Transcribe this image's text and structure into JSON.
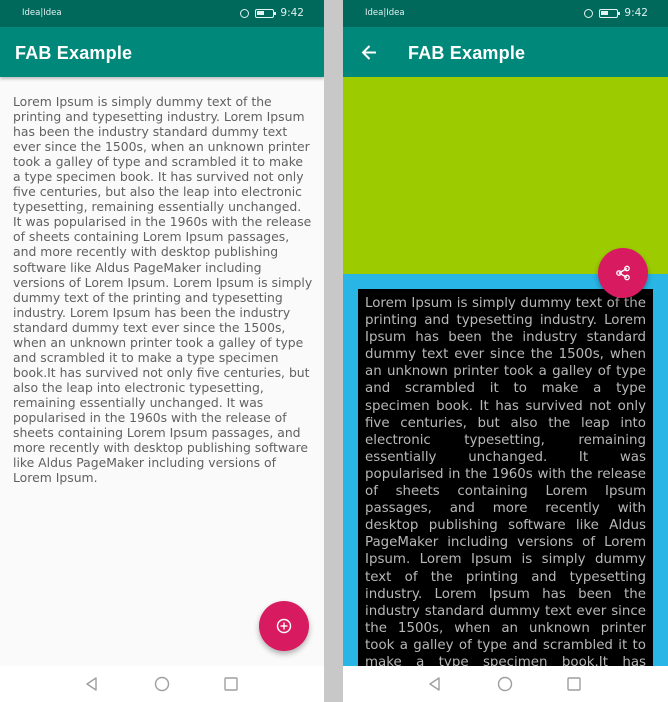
{
  "status_bar": {
    "carrier": "Idea|Idea",
    "time": "9:42"
  },
  "left_screen": {
    "title": "FAB Example",
    "body": "Lorem Ipsum is simply dummy text of the printing and typesetting industry. Lorem Ipsum has been the industry standard dummy text ever since the 1500s, when an unknown printer took a galley of type and scrambled it to make a type specimen book. It has survived not only five centuries, but also the leap into electronic typesetting, remaining essentially unchanged. It was popularised in the 1960s with the release of sheets containing Lorem Ipsum passages, and more recently with desktop publishing software like Aldus PageMaker including versions of Lorem Ipsum. Lorem Ipsum is simply dummy text of the printing and typesetting industry. Lorem Ipsum has been the industry standard dummy text ever since the 1500s, when an unknown printer took a galley of type and scrambled it to make a type specimen book.It has survived not only five centuries, but also the leap into electronic typesetting, remaining essentially unchanged. It was popularised in the 1960s with the release of sheets containing Lorem Ipsum passages, and more recently with desktop publishing software like Aldus PageMaker including versions of Lorem Ipsum.",
    "fab_icon": "add-circle-icon"
  },
  "right_screen": {
    "title": "FAB Example",
    "body": "Lorem Ipsum is simply dummy text of the printing and typesetting industry. Lorem Ipsum has been the industry standard dummy text ever since the 1500s, when an unknown printer took a galley of type and scrambled it to make a type specimen book. It has survived not only five centuries, but also the leap into electronic typesetting, remaining essentially unchanged. It was popularised in the 1960s with the release of sheets containing Lorem Ipsum passages, and more recently with desktop publishing software like Aldus PageMaker including versions of Lorem Ipsum. Lorem Ipsum is simply dummy text of the printing and typesetting industry. Lorem Ipsum has been the industry standard dummy text ever since the 1500s, when an unknown printer took a galley of type and scrambled it to make a type specimen book.It has survived not only five centuries, but also the leap into electronic typesetting, remaining essentially unchanged.",
    "fab_icon": "share-icon"
  },
  "colors": {
    "status_bar": "#00695c",
    "app_bar": "#00897b",
    "fab": "#d81b60",
    "green_block": "#9ccc00",
    "blue_block": "#29b6e6",
    "black_panel": "#000000"
  }
}
